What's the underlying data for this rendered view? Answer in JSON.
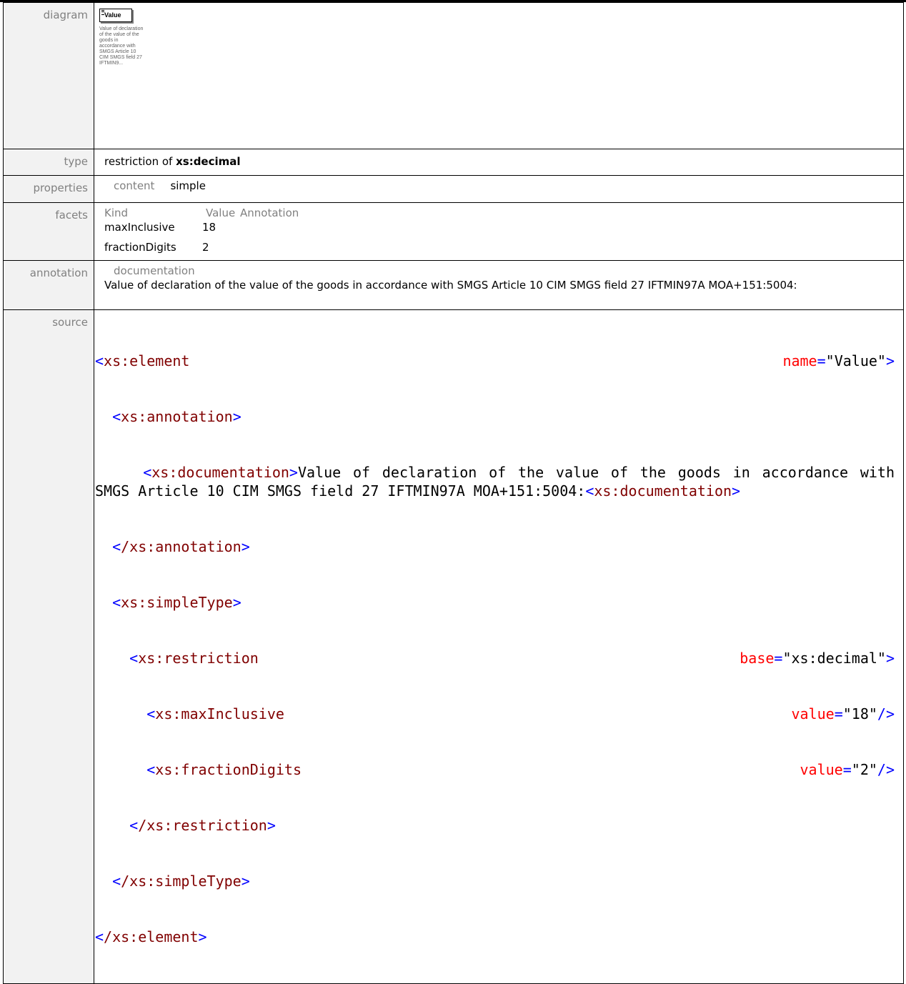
{
  "labels": {
    "diagram": "diagram",
    "type": "type",
    "properties": "properties",
    "facets": "facets",
    "annotation": "annotation",
    "source": "source"
  },
  "diagram": {
    "element_name": "Value",
    "doc_snippet": "Value of declaration of the value of the goods in accordance with SMGS Article 10 CIM SMGS field 27 IFTMIN9..."
  },
  "type": {
    "prefix": "restriction of",
    "base": "xs:decimal"
  },
  "properties": {
    "key": "content",
    "value": "simple"
  },
  "facets": {
    "headers": [
      "Kind",
      "Value",
      "Annotation"
    ],
    "rows": [
      {
        "kind": "maxInclusive",
        "value": "18"
      },
      {
        "kind": "fractionDigits",
        "value": "2"
      }
    ]
  },
  "annotation": {
    "heading": "documentation",
    "text": "Value of declaration of the value of the goods in accordance with  SMGS Article 10 CIM SMGS field 27 IFTMIN97A MOA+151:5004:"
  },
  "source": {
    "element_open": "xs:element",
    "element_attr": "name",
    "element_attr_val": "\"Value\"",
    "annotation_tag": "xs:annotation",
    "documentation_tag": "xs:documentation",
    "documentation_text": "Value of declaration of the value of the goods in accordance with  SMGS Article 10 CIM SMGS field 27 IFTMIN97A MOA+151:5004:",
    "annotation_close": "/xs:annotation",
    "simpletype_tag": "xs:simpleType",
    "restriction_tag": "xs:restriction",
    "restriction_attr": "base",
    "restriction_attr_val": "\"xs:decimal\"",
    "maxinclusive_tag": "xs:maxInclusive",
    "maxinclusive_attr": "value",
    "maxinclusive_attr_val": "\"18\"",
    "fractiondigits_tag": "xs:fractionDigits",
    "fractiondigits_attr": "value",
    "fractiondigits_attr_val": "\"2\"",
    "restriction_close": "/xs:restriction",
    "simpletype_close": "/xs:simpleType",
    "element_close": "/xs:element"
  },
  "colors": {
    "tag": "#800000",
    "bracket": "#0000ff",
    "attribute": "#ff0000",
    "label_text": "#808080",
    "label_bg": "#f2f2f2"
  }
}
